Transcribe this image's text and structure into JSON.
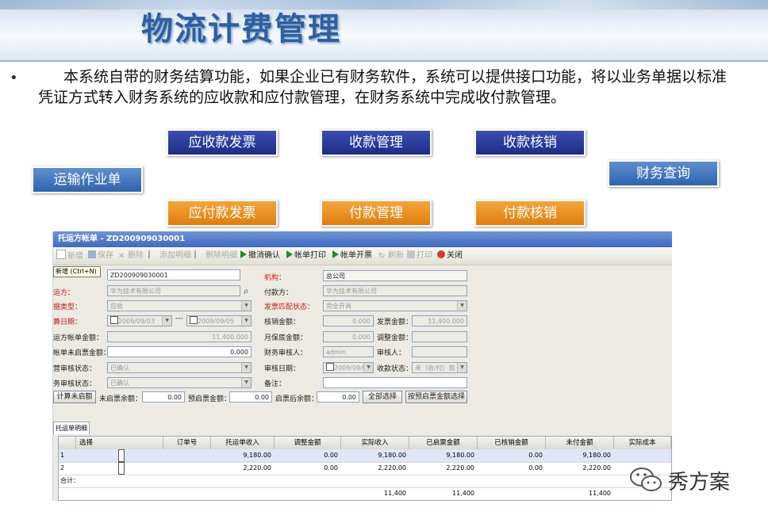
{
  "slide": {
    "title": "物流计费管理",
    "bullet": "•",
    "paragraph": "本系统自带的财务结算功能，如果企业已有财务软件，系统可以提供接口功能，将以业务单据以标准凭证方式转入财务系统的应收款和应付款管理，在财务系统中完成收付款管理。"
  },
  "flow": {
    "ar_invoice": "应收款发票",
    "receipt_mgmt": "收款管理",
    "receipt_writeoff": "收款核销",
    "transport_order": "运输作业单",
    "finance_query": "财务查询",
    "ap_invoice": "应付款发票",
    "payment_mgmt": "付款管理",
    "payment_writeoff": "付款核销"
  },
  "window": {
    "title": "托运方帐单 - ZD200909030001",
    "toolbar": {
      "new": "新增",
      "save": "保存",
      "delete": "删除",
      "add_detail": "添加明细",
      "delete_detail": "删除明细",
      "cancel_confirm": "撤消确认",
      "bill_print": "帐单打印",
      "bill_invoice": "帐单开票",
      "refresh": "刷新",
      "print": "打印",
      "close": "关闭"
    },
    "tooltip": "新增 (Ctrl+N)",
    "form": {
      "bill_no_value": "ZD200909030001",
      "shipper_label": "运方：",
      "shipper_value": "华为技术有限公司",
      "type_label": "据类型：",
      "type_value": "应收",
      "date_label": "算日期：",
      "date_from": "2009/09/03",
      "date_sep": "---",
      "date_to": "2009/09/05",
      "bill_amount_label": "运方帐单金额：",
      "bill_amount_value": "11,400.000",
      "unbilled_label": "帐单未启票金额：",
      "unbilled_value": "0.000",
      "audit_status_label": "营审核状态：",
      "audit_status_value": "已确认",
      "fin_audit_label": "务审核状态：",
      "fin_audit_value": "已确认",
      "org_label": "机构：",
      "org_value": "总公司",
      "payer_label": "付款方：",
      "payer_value": "华为技术有限公司",
      "match_label": "发票匹配状态：",
      "match_value": "完全开具",
      "writeoff_label": "核销金额：",
      "writeoff_value": "0.000",
      "invoice_amt_label": "发票金额：",
      "invoice_amt_value": "11,400.000",
      "month_label": "月保底金额：",
      "month_value": "0.000",
      "adjust_label": "调整金额：",
      "auditor_label": "财务审核人：",
      "auditor_value": "admin",
      "reviewer_label": "审核人：",
      "audit_date_label": "审核日期：",
      "audit_date_value": "2009/09/03",
      "recv_status_label": "收款状态：",
      "recv_status_value": "未（收/付）款",
      "remark_label": "备注：",
      "calc_btn": "计算未启额",
      "unbilled_bal_label": "未启票余额：",
      "unbilled_bal_value": "0.00",
      "pre_bill_label": "预启票金额：",
      "pre_bill_value": "0.00",
      "after_bal_label": "启票后余额：",
      "after_bal_value": "0.00",
      "select_all_btn": "全部选择",
      "select_by_btn": "按预启票金额选择"
    },
    "tab_label": "托运单明细",
    "grid": {
      "columns": [
        "",
        "选择",
        "订单号",
        "托运单收入",
        "调整金额",
        "实际收入",
        "已启票金额",
        "已核销金额",
        "未付金额",
        "实际成本"
      ],
      "rows": [
        {
          "no": "1",
          "income": "9,180.00",
          "adjust": "0.00",
          "actual": "9,180.00",
          "billed": "9,180.00",
          "writeoff": "0.00",
          "unpaid": "9,180.00"
        },
        {
          "no": "2",
          "income": "2,220.00",
          "adjust": "0.00",
          "actual": "2,220.00",
          "billed": "2,220.00",
          "writeoff": "0.00",
          "unpaid": "2,220.00"
        }
      ],
      "total_label": "合计：",
      "totals": {
        "actual": "11,400",
        "billed": "11,400",
        "unpaid": "11,400"
      }
    }
  },
  "watermark": "秀方案",
  "colors": {
    "title": "#2f5f9e",
    "flow_blue": "#1d2c86",
    "flow_orange": "#e07d0c",
    "flow_steel": "#2f63ad"
  }
}
